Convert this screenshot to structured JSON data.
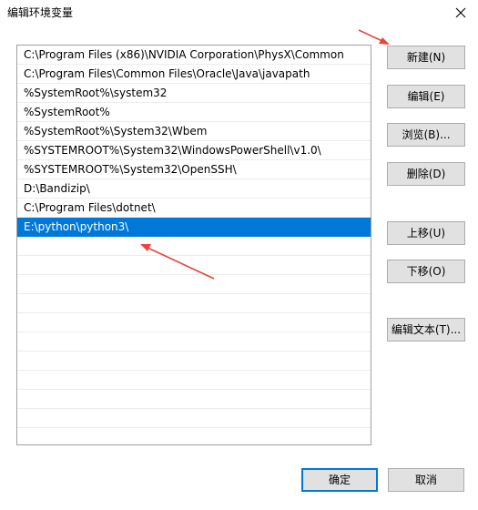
{
  "window": {
    "title": "编辑环境变量",
    "close_icon": "close-icon"
  },
  "path_list": {
    "items": [
      "C:\\Program Files (x86)\\NVIDIA Corporation\\PhysX\\Common",
      "C:\\Program Files\\Common Files\\Oracle\\Java\\javapath",
      "%SystemRoot%\\system32",
      "%SystemRoot%",
      "%SystemRoot%\\System32\\Wbem",
      "%SYSTEMROOT%\\System32\\WindowsPowerShell\\v1.0\\",
      "%SYSTEMROOT%\\System32\\OpenSSH\\",
      "D:\\Bandizip\\",
      "C:\\Program Files\\dotnet\\",
      "E:\\python\\python3\\"
    ],
    "selected_index": 9,
    "selection_color": "#0078d7"
  },
  "buttons": {
    "new": "新建(N)",
    "edit": "编辑(E)",
    "browse": "浏览(B)...",
    "delete": "删除(D)",
    "move_up": "上移(U)",
    "move_down": "下移(O)",
    "edit_text": "编辑文本(T)...",
    "ok": "确定",
    "cancel": "取消"
  },
  "annotation_color": "#e8463c"
}
